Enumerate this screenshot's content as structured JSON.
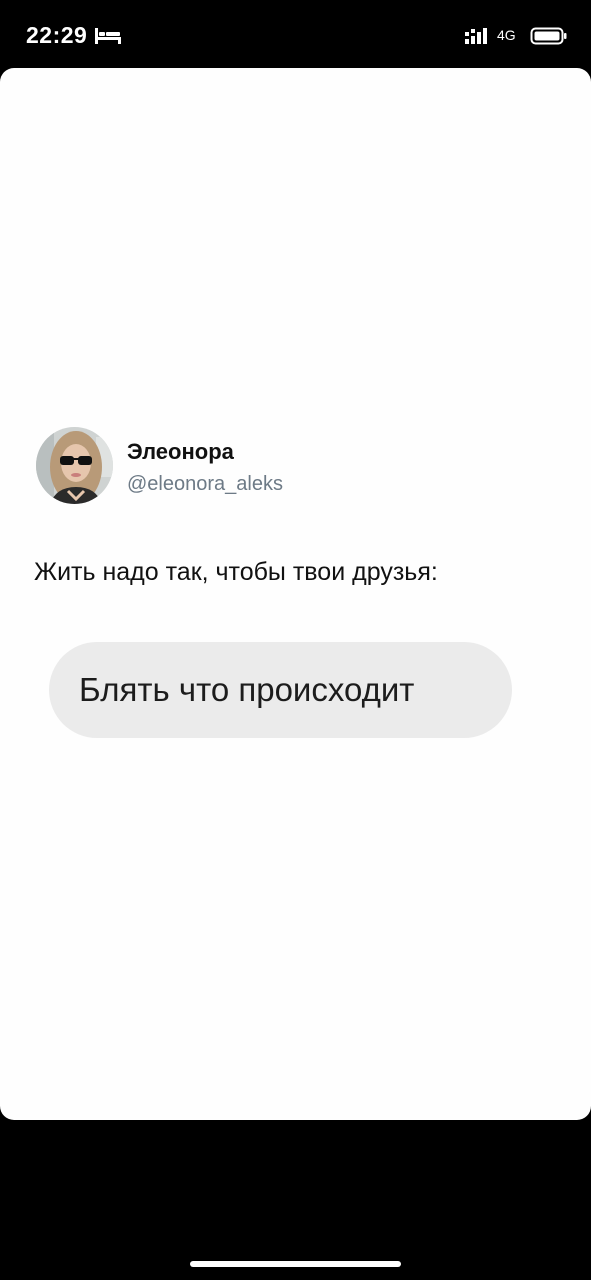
{
  "status_bar": {
    "time": "22:29",
    "network": "4G",
    "icons": [
      "bed-icon",
      "signal-icon",
      "battery-icon"
    ]
  },
  "tweet": {
    "display_name": "Элеонора",
    "handle": "@eleonora_aleks",
    "text": "Жить надо так, чтобы твои друзья:",
    "bubble_text": "Блять что происходит"
  },
  "colors": {
    "background": "#000000",
    "card": "#fefefe",
    "bubble": "#ebebeb",
    "handle": "#6d7a86"
  }
}
